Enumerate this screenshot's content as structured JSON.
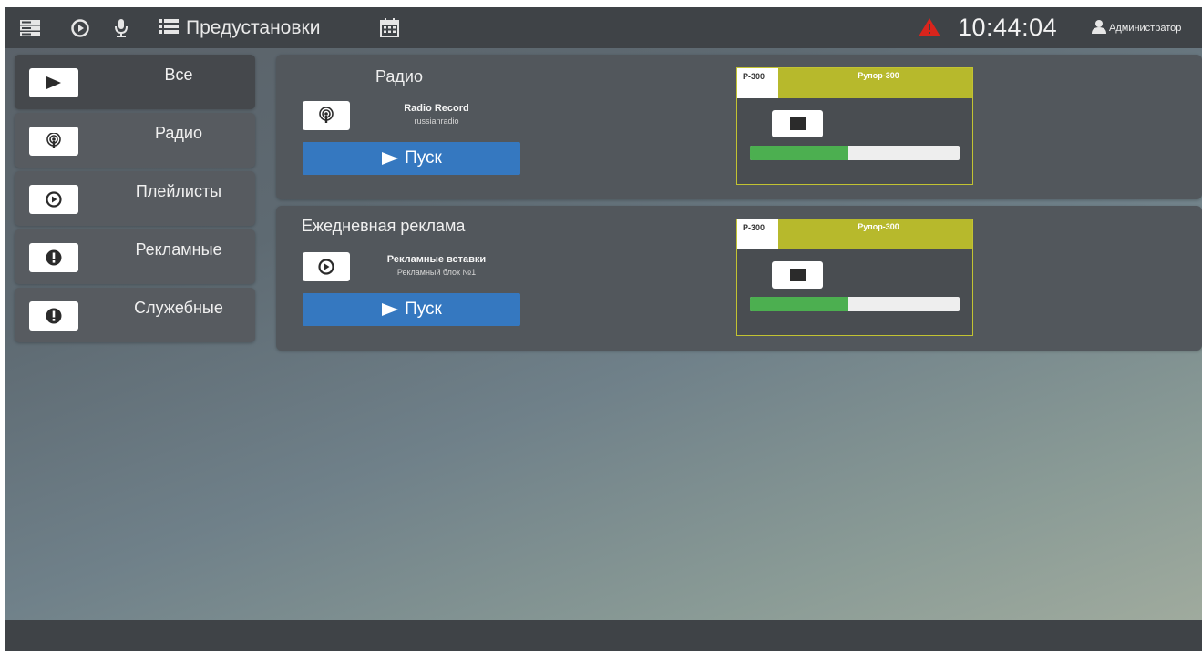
{
  "topbar": {
    "presets_label": "Предустановки",
    "clock": "10:44:04",
    "user": "Администратор",
    "alert_color": "#d9241c",
    "icons": [
      "server-icon",
      "play-circle-icon",
      "microphone-icon",
      "list-icon",
      "calendar-icon",
      "warning-icon",
      "user-icon"
    ]
  },
  "sidebar": {
    "items": [
      {
        "label": "Все",
        "icon": "play-icon",
        "active": true
      },
      {
        "label": "Радио",
        "icon": "podcast-icon",
        "active": false
      },
      {
        "label": "Плейлисты",
        "icon": "play-circle-icon",
        "active": false
      },
      {
        "label": "Рекламные",
        "icon": "exclamation-circle-icon",
        "active": false
      },
      {
        "label": "Служебные",
        "icon": "exclamation-circle-icon",
        "active": false
      }
    ]
  },
  "presets": [
    {
      "title": "Радио",
      "source_name": "Radio Record",
      "source_sub": "russianradio",
      "source_icon": "podcast-icon",
      "button_label": "Пуск",
      "device": {
        "id": "P-300",
        "name": "Рупор-300",
        "volume": 0.47
      }
    },
    {
      "title": "Ежедневная реклама",
      "source_name": "Рекламные вставки",
      "source_sub": "Рекламный блок №1",
      "source_icon": "play-circle-icon",
      "button_label": "Пуск",
      "device": {
        "id": "P-300",
        "name": "Рупор-300",
        "volume": 0.47
      }
    }
  ],
  "colors": {
    "accent": "#3578c0",
    "device_header": "#b7b92c",
    "progress": "#4caf50"
  }
}
